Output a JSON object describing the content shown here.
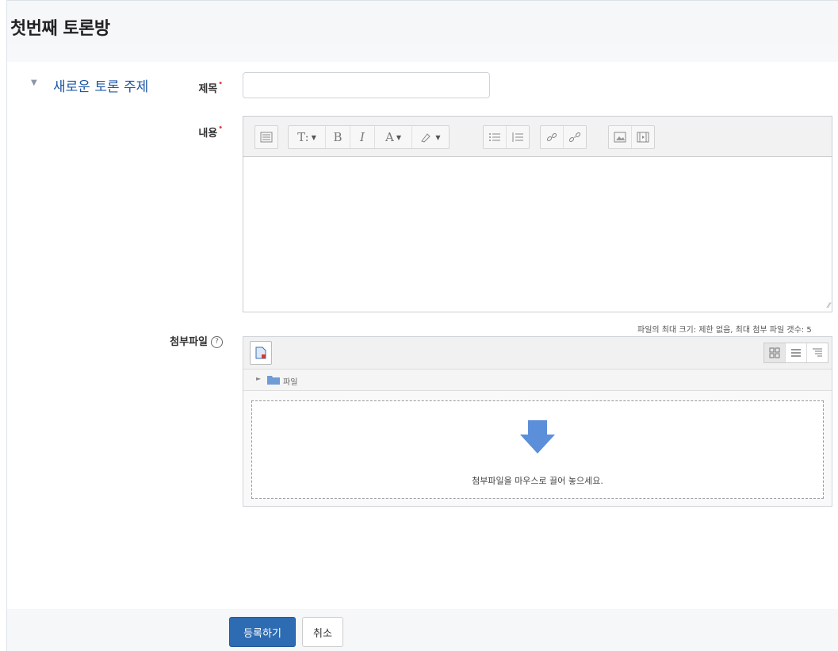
{
  "page": {
    "title": "첫번째 토론방"
  },
  "section": {
    "toggle_glyph": "▼",
    "title": "새로운 토론 주제"
  },
  "form": {
    "subject_label": "제목",
    "message_label": "내용",
    "attachment_label": "첨부파일",
    "required_mark": "•",
    "help_glyph": "?",
    "subject_value": ""
  },
  "editor": {
    "toolbar": {
      "groups": [
        [
          "toolbar-toggle-icon"
        ],
        [
          "T:",
          "B",
          "I",
          "A",
          "brush"
        ],
        [
          "unordered-list-icon",
          "ordered-list-icon"
        ],
        [
          "link-icon",
          "unlink-icon"
        ],
        [
          "image-icon",
          "media-icon"
        ]
      ]
    },
    "content": ""
  },
  "filepicker": {
    "limit_text": "파일의 최대 크기: 제한 없음, 최대 첨부 파일 갯수: 5",
    "folder_label": "파일",
    "drop_text": "첨부파일을 마우스로 끌어 놓으세요.",
    "colors": {
      "arrow": "#5b8fd9"
    }
  },
  "actions": {
    "submit_label": "등록하기",
    "cancel_label": "취소"
  },
  "colors": {
    "primary": "#2d6bb3",
    "section_title": "#1d57a6",
    "required": "#e64545"
  }
}
